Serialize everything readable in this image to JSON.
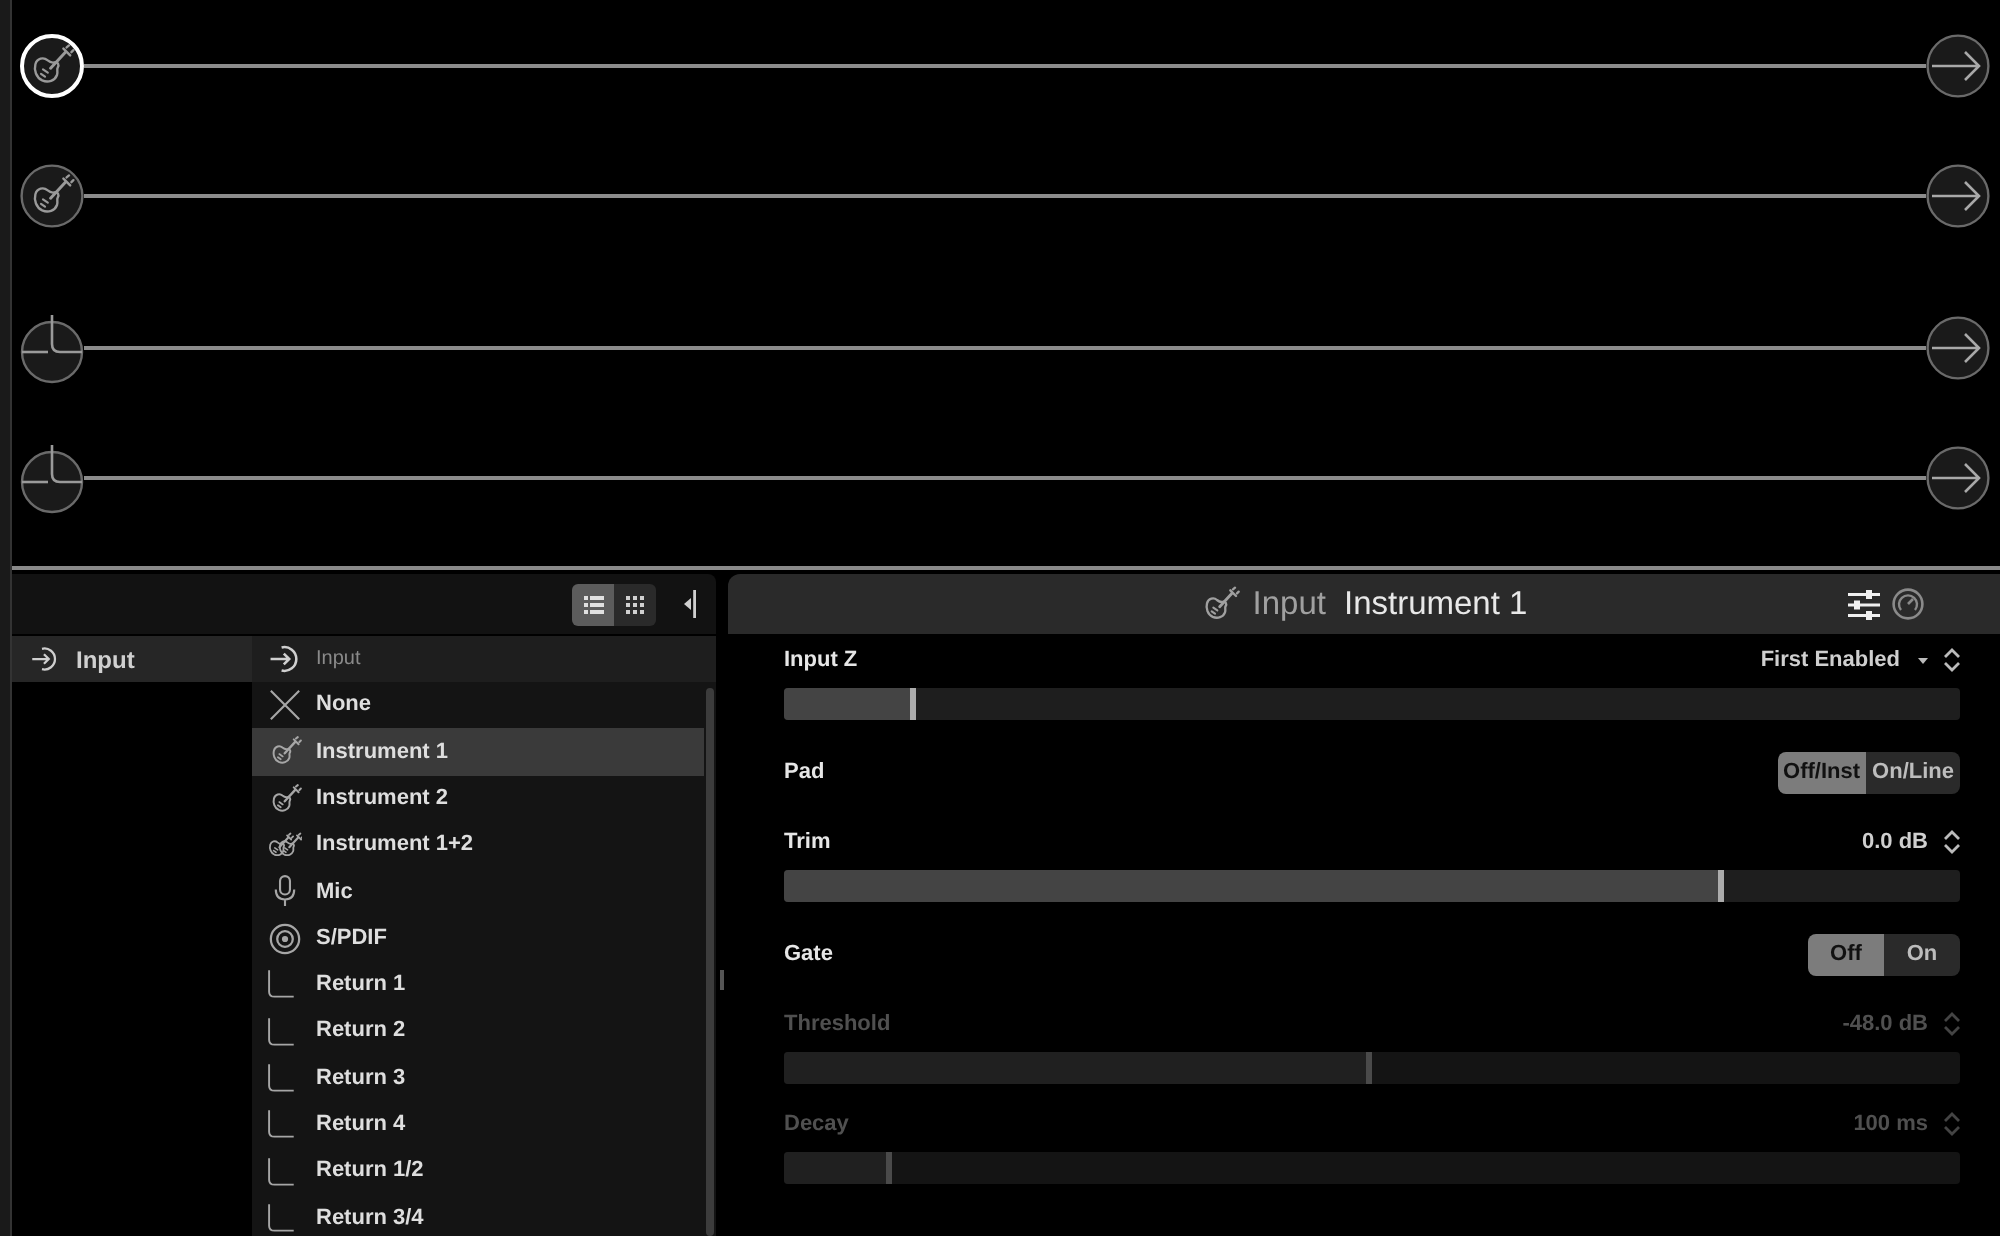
{
  "signal_chain": {
    "paths": [
      {
        "lanes": [
          {
            "input": {
              "kind": "guitar",
              "selected": true
            }
          },
          {
            "input": {
              "kind": "guitar",
              "selected": false
            }
          }
        ]
      },
      {
        "lanes": [
          {
            "input": {
              "kind": "return",
              "selected": false
            }
          },
          {
            "input": {
              "kind": "return",
              "selected": false
            }
          }
        ]
      }
    ]
  },
  "browser": {
    "view_modes": [
      {
        "kind": "list",
        "selected": true
      },
      {
        "kind": "grid",
        "selected": false
      }
    ],
    "categories": [
      {
        "label": "Input",
        "selected": true
      }
    ],
    "list_title": "Input",
    "items": [
      {
        "label": "None",
        "kind": "none",
        "selected": false
      },
      {
        "label": "Instrument 1",
        "kind": "guitar",
        "selected": true
      },
      {
        "label": "Instrument 2",
        "kind": "guitar",
        "selected": false
      },
      {
        "label": "Instrument 1+2",
        "kind": "guitars",
        "selected": false
      },
      {
        "label": "Mic",
        "kind": "mic",
        "selected": false
      },
      {
        "label": "S/PDIF",
        "kind": "spdif",
        "selected": false
      },
      {
        "label": "Return 1",
        "kind": "return",
        "selected": false
      },
      {
        "label": "Return 2",
        "kind": "return",
        "selected": false
      },
      {
        "label": "Return 3",
        "kind": "return",
        "selected": false
      },
      {
        "label": "Return 4",
        "kind": "return",
        "selected": false
      },
      {
        "label": "Return 1/2",
        "kind": "return",
        "selected": false
      },
      {
        "label": "Return 3/4",
        "kind": "return",
        "selected": false
      }
    ]
  },
  "inspector": {
    "title": {
      "category": "Input",
      "model": "Instrument 1"
    },
    "params": [
      {
        "kind": "slider",
        "label": "Input Z",
        "value": "First Enabled",
        "menu": true,
        "level": 0.112,
        "disabled": false
      },
      {
        "kind": "switch",
        "label": "Pad",
        "options": [
          {
            "label": "Off/Inst",
            "selected": true
          },
          {
            "label": "On/Line",
            "selected": false
          }
        ]
      },
      {
        "kind": "slider",
        "label": "Trim",
        "value": "0.0 dB",
        "level": 0.8,
        "disabled": false
      },
      {
        "kind": "switch",
        "label": "Gate",
        "options": [
          {
            "label": "Off",
            "selected": true
          },
          {
            "label": "On",
            "selected": false
          }
        ]
      },
      {
        "kind": "slider",
        "label": "Threshold",
        "value": "-48.0 dB",
        "level": 0.5,
        "disabled": true
      },
      {
        "kind": "slider",
        "label": "Decay",
        "value": "100 ms",
        "level": 0.092,
        "disabled": true
      }
    ]
  }
}
